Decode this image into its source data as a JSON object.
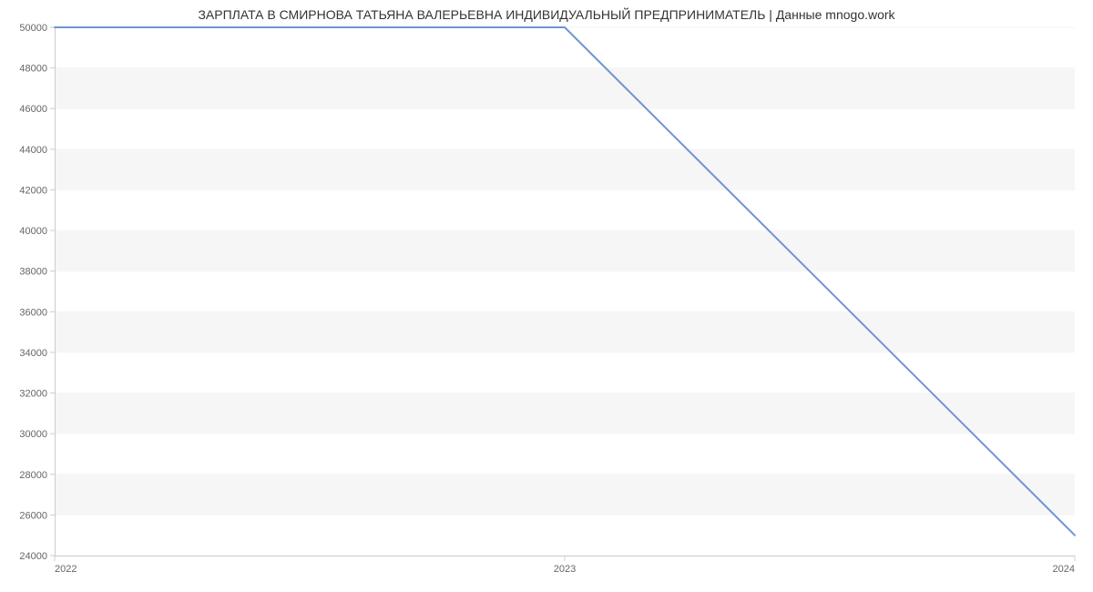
{
  "chart_data": {
    "type": "line",
    "title": "ЗАРПЛАТА В СМИРНОВА ТАТЬЯНА ВАЛЕРЬЕВНА ИНДИВИДУАЛЬНЫЙ ПРЕДПРИНИМАТЕЛЬ | Данные mnogo.work",
    "x": [
      2022,
      2023,
      2024
    ],
    "values": [
      50000,
      50000,
      25000
    ],
    "x_ticks": [
      "2022",
      "2023",
      "2024"
    ],
    "y_ticks": [
      24000,
      26000,
      28000,
      30000,
      32000,
      34000,
      36000,
      38000,
      40000,
      42000,
      44000,
      46000,
      48000,
      50000
    ],
    "xlabel": "",
    "ylabel": "",
    "ylim": [
      24000,
      50000
    ],
    "xlim": [
      2022,
      2024
    ],
    "line_color": "#6f94d6",
    "band_color": "#f6f6f6",
    "axis_color": "#cccccc"
  }
}
